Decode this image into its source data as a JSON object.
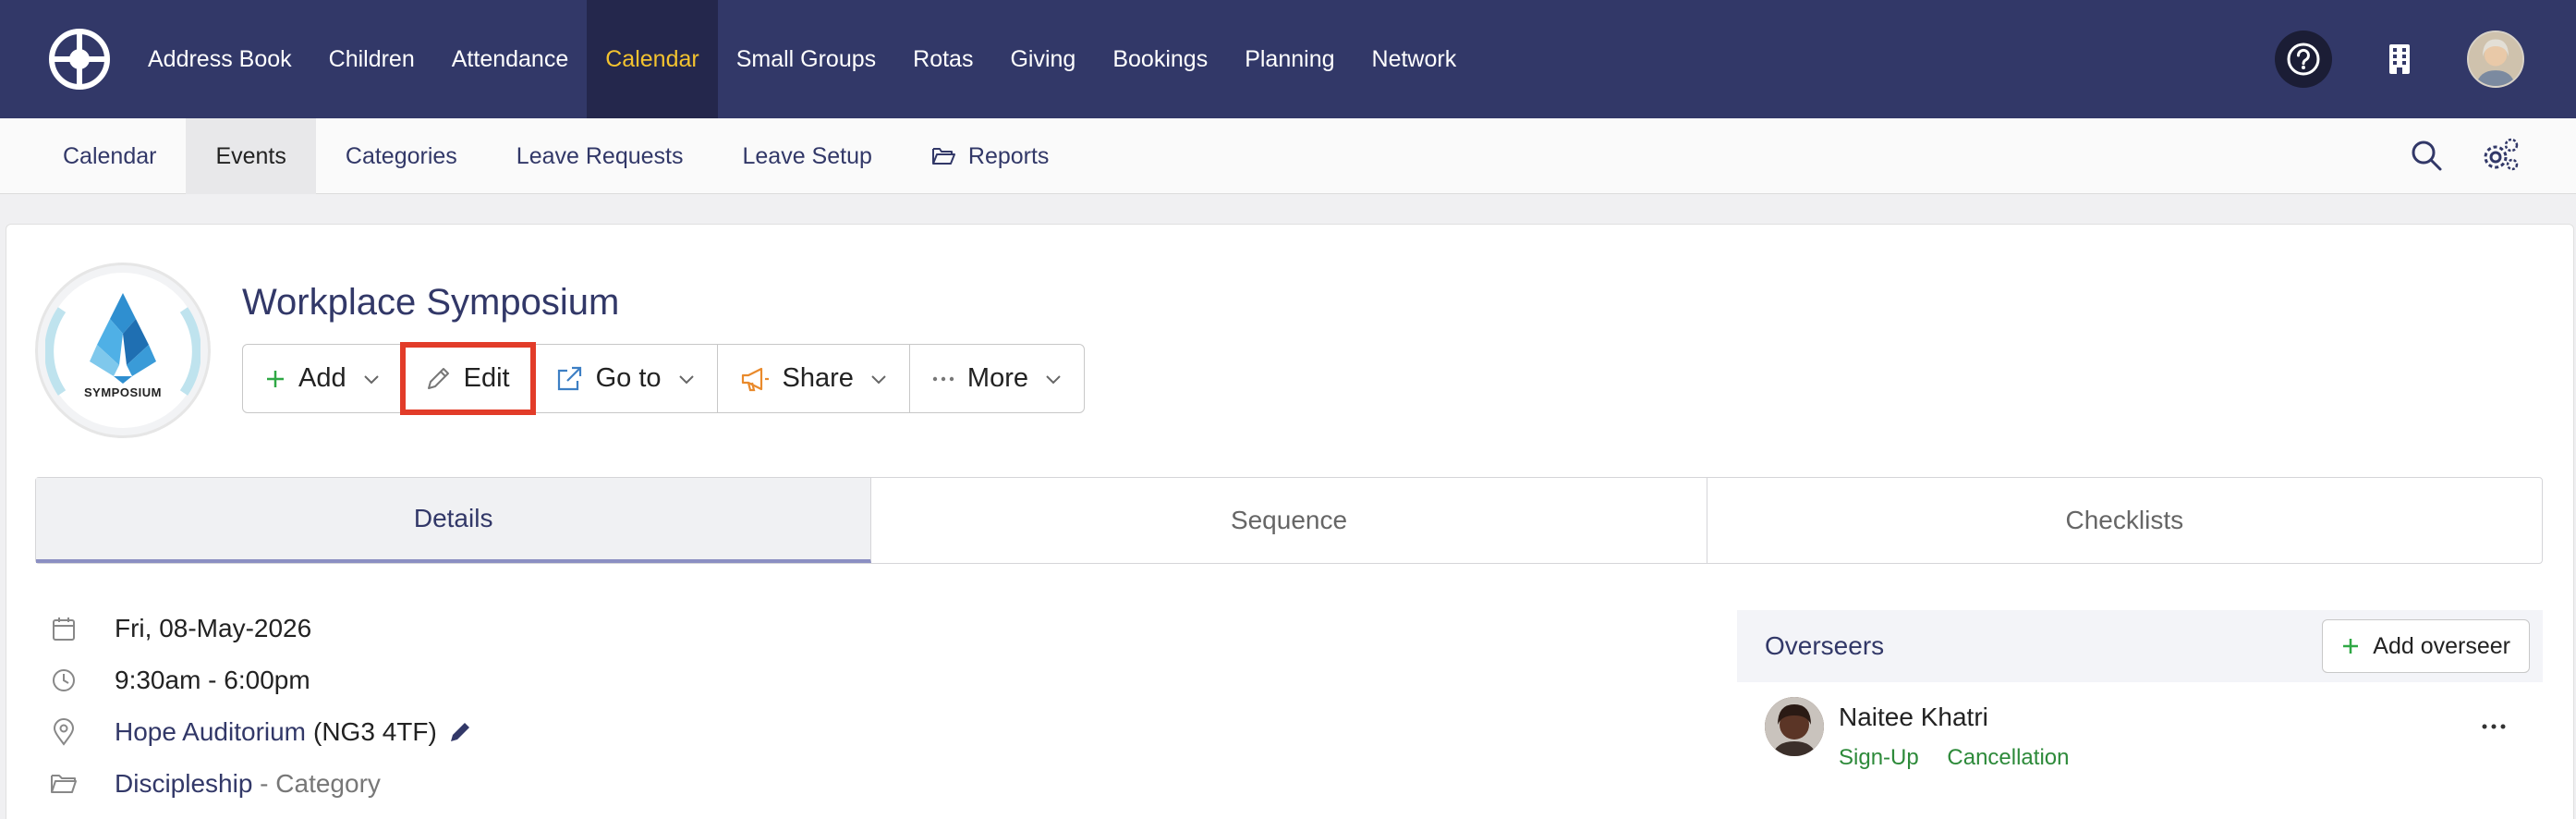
{
  "topnav": {
    "items": [
      {
        "label": "Address Book"
      },
      {
        "label": "Children"
      },
      {
        "label": "Attendance"
      },
      {
        "label": "Calendar",
        "active": true
      },
      {
        "label": "Small Groups"
      },
      {
        "label": "Rotas"
      },
      {
        "label": "Giving"
      },
      {
        "label": "Bookings"
      },
      {
        "label": "Planning"
      },
      {
        "label": "Network"
      }
    ],
    "icons": [
      "logo-icon",
      "help-icon",
      "building-icon",
      "user-avatar"
    ],
    "active_color": "#f3c32f",
    "background": "#323868"
  },
  "subnav": {
    "items": [
      {
        "label": "Calendar"
      },
      {
        "label": "Events",
        "active": true
      },
      {
        "label": "Categories"
      },
      {
        "label": "Leave Requests"
      },
      {
        "label": "Leave Setup"
      },
      {
        "label": "Reports",
        "icon": "folder-open-icon"
      }
    ],
    "icons": [
      "search-icon",
      "settings-icon"
    ]
  },
  "event": {
    "logo_text": "SYMPOSIUM",
    "title": "Workplace Symposium",
    "toolbar": {
      "add_label": "Add",
      "edit_label": "Edit",
      "goto_label": "Go to",
      "share_label": "Share",
      "more_label": "More",
      "highlighted": "Edit",
      "highlight_color": "#e23c29"
    }
  },
  "tabs": [
    {
      "label": "Details",
      "active": true
    },
    {
      "label": "Sequence"
    },
    {
      "label": "Checklists"
    }
  ],
  "details": {
    "date": "Fri, 08-May-2026",
    "time": "9:30am - 6:00pm",
    "location_name": "Hope Auditorium",
    "location_postcode": "(NG3 4TF)",
    "category_name": "Discipleship",
    "category_suffix": " - Category"
  },
  "overseers": {
    "title": "Overseers",
    "add_label": "Add overseer",
    "people": [
      {
        "name": "Naitee Khatri",
        "links": [
          "Sign-Up",
          "Cancellation"
        ]
      }
    ]
  }
}
